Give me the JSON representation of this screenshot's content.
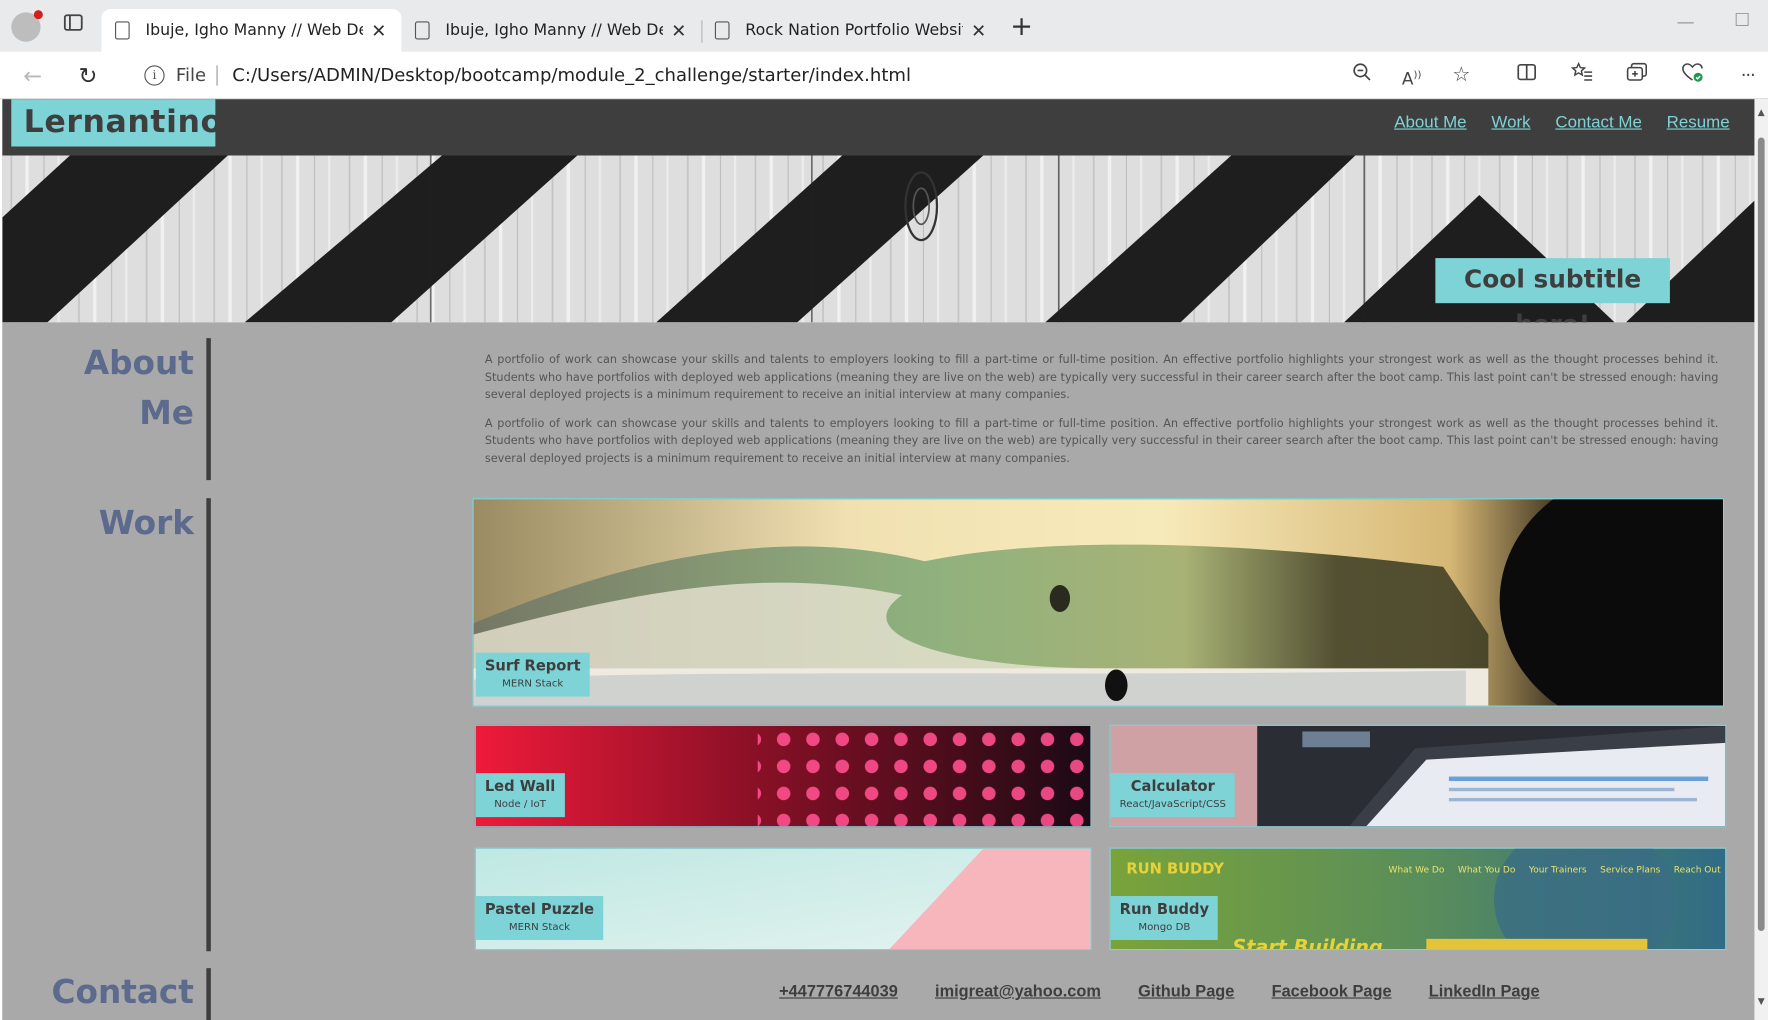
{
  "browser": {
    "tabs": [
      {
        "title": "Ibuje, Igho Manny // Web Developer",
        "active": true
      },
      {
        "title": "Ibuje, Igho Manny // Web Developer",
        "active": false
      },
      {
        "title": "Rock Nation Portfolio Website",
        "active": false
      }
    ],
    "address": {
      "scheme_label": "File",
      "url": "C:/Users/ADMIN/Desktop/bootcamp/module_2_challenge/starter/index.html"
    }
  },
  "site": {
    "logo": "Lernantino",
    "nav": [
      "About Me",
      "Work",
      "Contact Me",
      "Resume"
    ],
    "hero_subtitle": "Cool subtitle here!",
    "sections": {
      "about": {
        "title_line1": "About",
        "title_line2": "Me"
      },
      "work": {
        "title": "Work"
      },
      "contact": {
        "title": "Contact"
      }
    },
    "about_paragraphs": [
      "A portfolio of work can showcase your skills and talents to employers looking to fill a part-time or full-time position. An effective portfolio highlights your strongest work as well as the thought processes behind it. Students who have portfolios with deployed web applications (meaning they are live on the web) are typically very successful in their career search after the boot camp. This last point can't be stressed enough: having several deployed projects is a minimum requirement to receive an initial interview at many companies.",
      "A portfolio of work can showcase your skills and talents to employers looking to fill a part-time or full-time position. An effective portfolio highlights your strongest work as well as the thought processes behind it. Students who have portfolios with deployed web applications (meaning they are live on the web) are typically very successful in their career search after the boot camp. This last point can't be stressed enough: having several deployed projects is a minimum requirement to receive an initial interview at many companies."
    ],
    "projects": [
      {
        "name": "Surf Report",
        "tech": "MERN Stack"
      },
      {
        "name": "Led Wall",
        "tech": "Node / IoT"
      },
      {
        "name": "Calculator",
        "tech": "React/JavaScript/CSS"
      },
      {
        "name": "Pastel Puzzle",
        "tech": "MERN Stack"
      },
      {
        "name": "Run Buddy",
        "tech": "Mongo DB"
      }
    ],
    "run_buddy_preview": {
      "brand": "RUN BUDDY",
      "nav": [
        "What We Do",
        "What You Do",
        "Your Trainers",
        "Service Plans",
        "Reach Out"
      ],
      "headline": "Start Building"
    },
    "contact_links": [
      "+447776744039",
      "imigreat@yahoo.com",
      "Github Page",
      "Facebook Page",
      "LinkedIn Page"
    ]
  },
  "colors": {
    "accent": "#7ed3d6",
    "header_bg": "#3e3e3e",
    "page_bg": "#a9a9a9",
    "section_title": "#5b6a8d"
  }
}
